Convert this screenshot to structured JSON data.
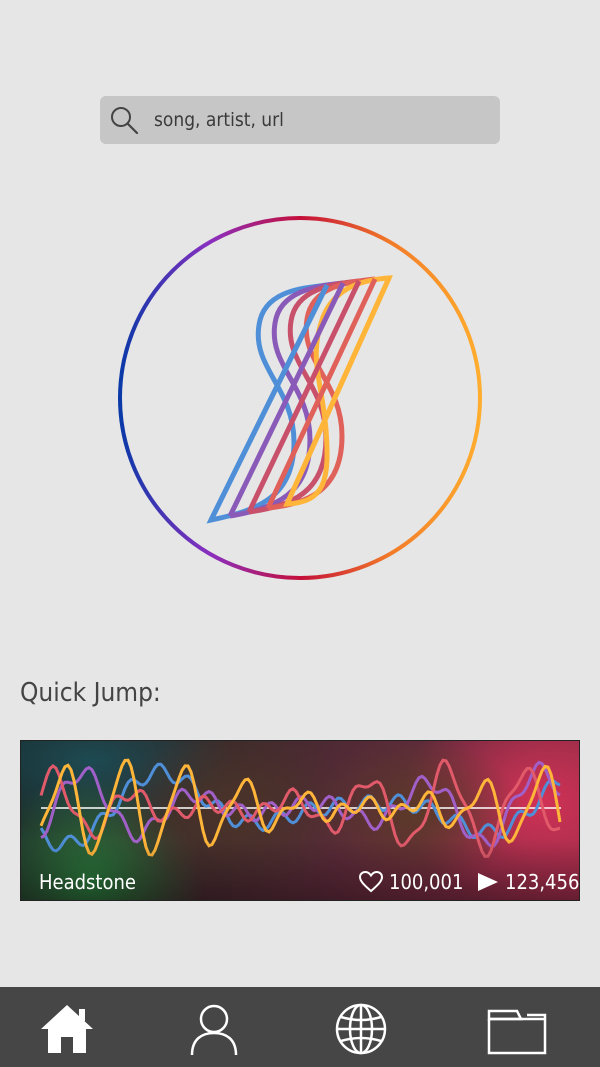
{
  "search": {
    "placeholder": "song, artist, url",
    "icon": "search-icon"
  },
  "logo": {
    "icon": "spectrum-s-logo",
    "ring_colors": [
      "#0a39a8",
      "#8a2fc0",
      "#c40f3a",
      "#f27a28",
      "#ffad2e"
    ],
    "stroke_colors": [
      "#4f8fd8",
      "#8a5ab8",
      "#c8506a",
      "#e0605a",
      "#ffb53a"
    ]
  },
  "quick_jump": {
    "title": "Quick Jump:",
    "card": {
      "song": "Headstone",
      "likes": "100,001",
      "plays": "123,456",
      "likes_icon": "heart-icon",
      "plays_icon": "play-icon"
    }
  },
  "nav": [
    {
      "name": "home",
      "icon": "home-icon",
      "active": true
    },
    {
      "name": "profile",
      "icon": "user-icon",
      "active": false
    },
    {
      "name": "explore",
      "icon": "globe-icon",
      "active": false
    },
    {
      "name": "library",
      "icon": "folder-icon",
      "active": false
    }
  ]
}
